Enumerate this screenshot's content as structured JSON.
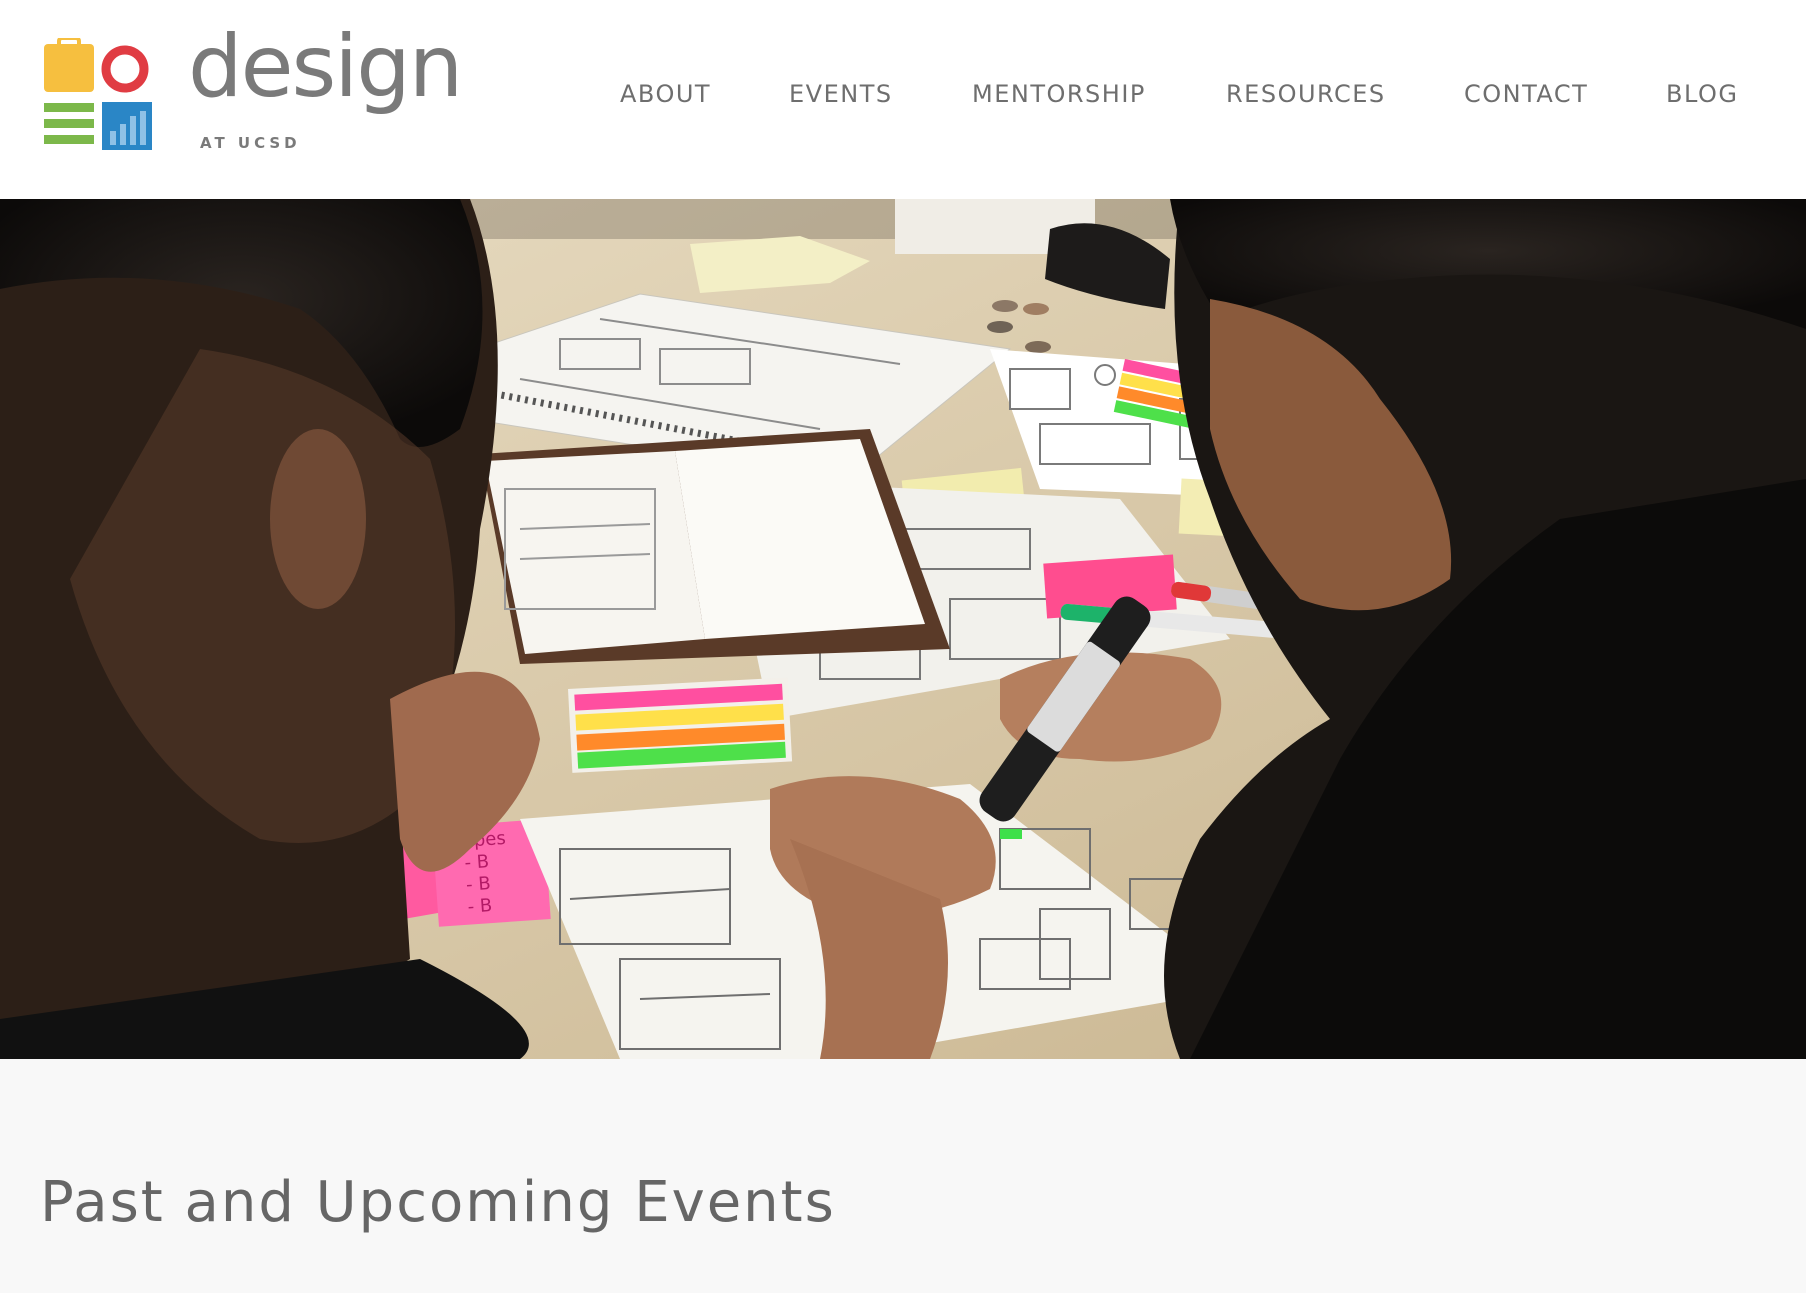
{
  "logo": {
    "wordmark": "design",
    "subtitle": "AT UCSD",
    "colors": {
      "yellow": "#f6bf3f",
      "red": "#e03c43",
      "green": "#7cb84a",
      "blue": "#2a86c6"
    }
  },
  "nav": {
    "items": [
      {
        "label": "ABOUT"
      },
      {
        "label": "EVENTS"
      },
      {
        "label": "MENTORSHIP"
      },
      {
        "label": "RESOURCES"
      },
      {
        "label": "CONTACT"
      },
      {
        "label": "BLOG"
      }
    ]
  },
  "hero": {
    "sticky_note": [
      "Types",
      "- B",
      "- B",
      "- B"
    ]
  },
  "events": {
    "title": "Past and Upcoming Events"
  }
}
